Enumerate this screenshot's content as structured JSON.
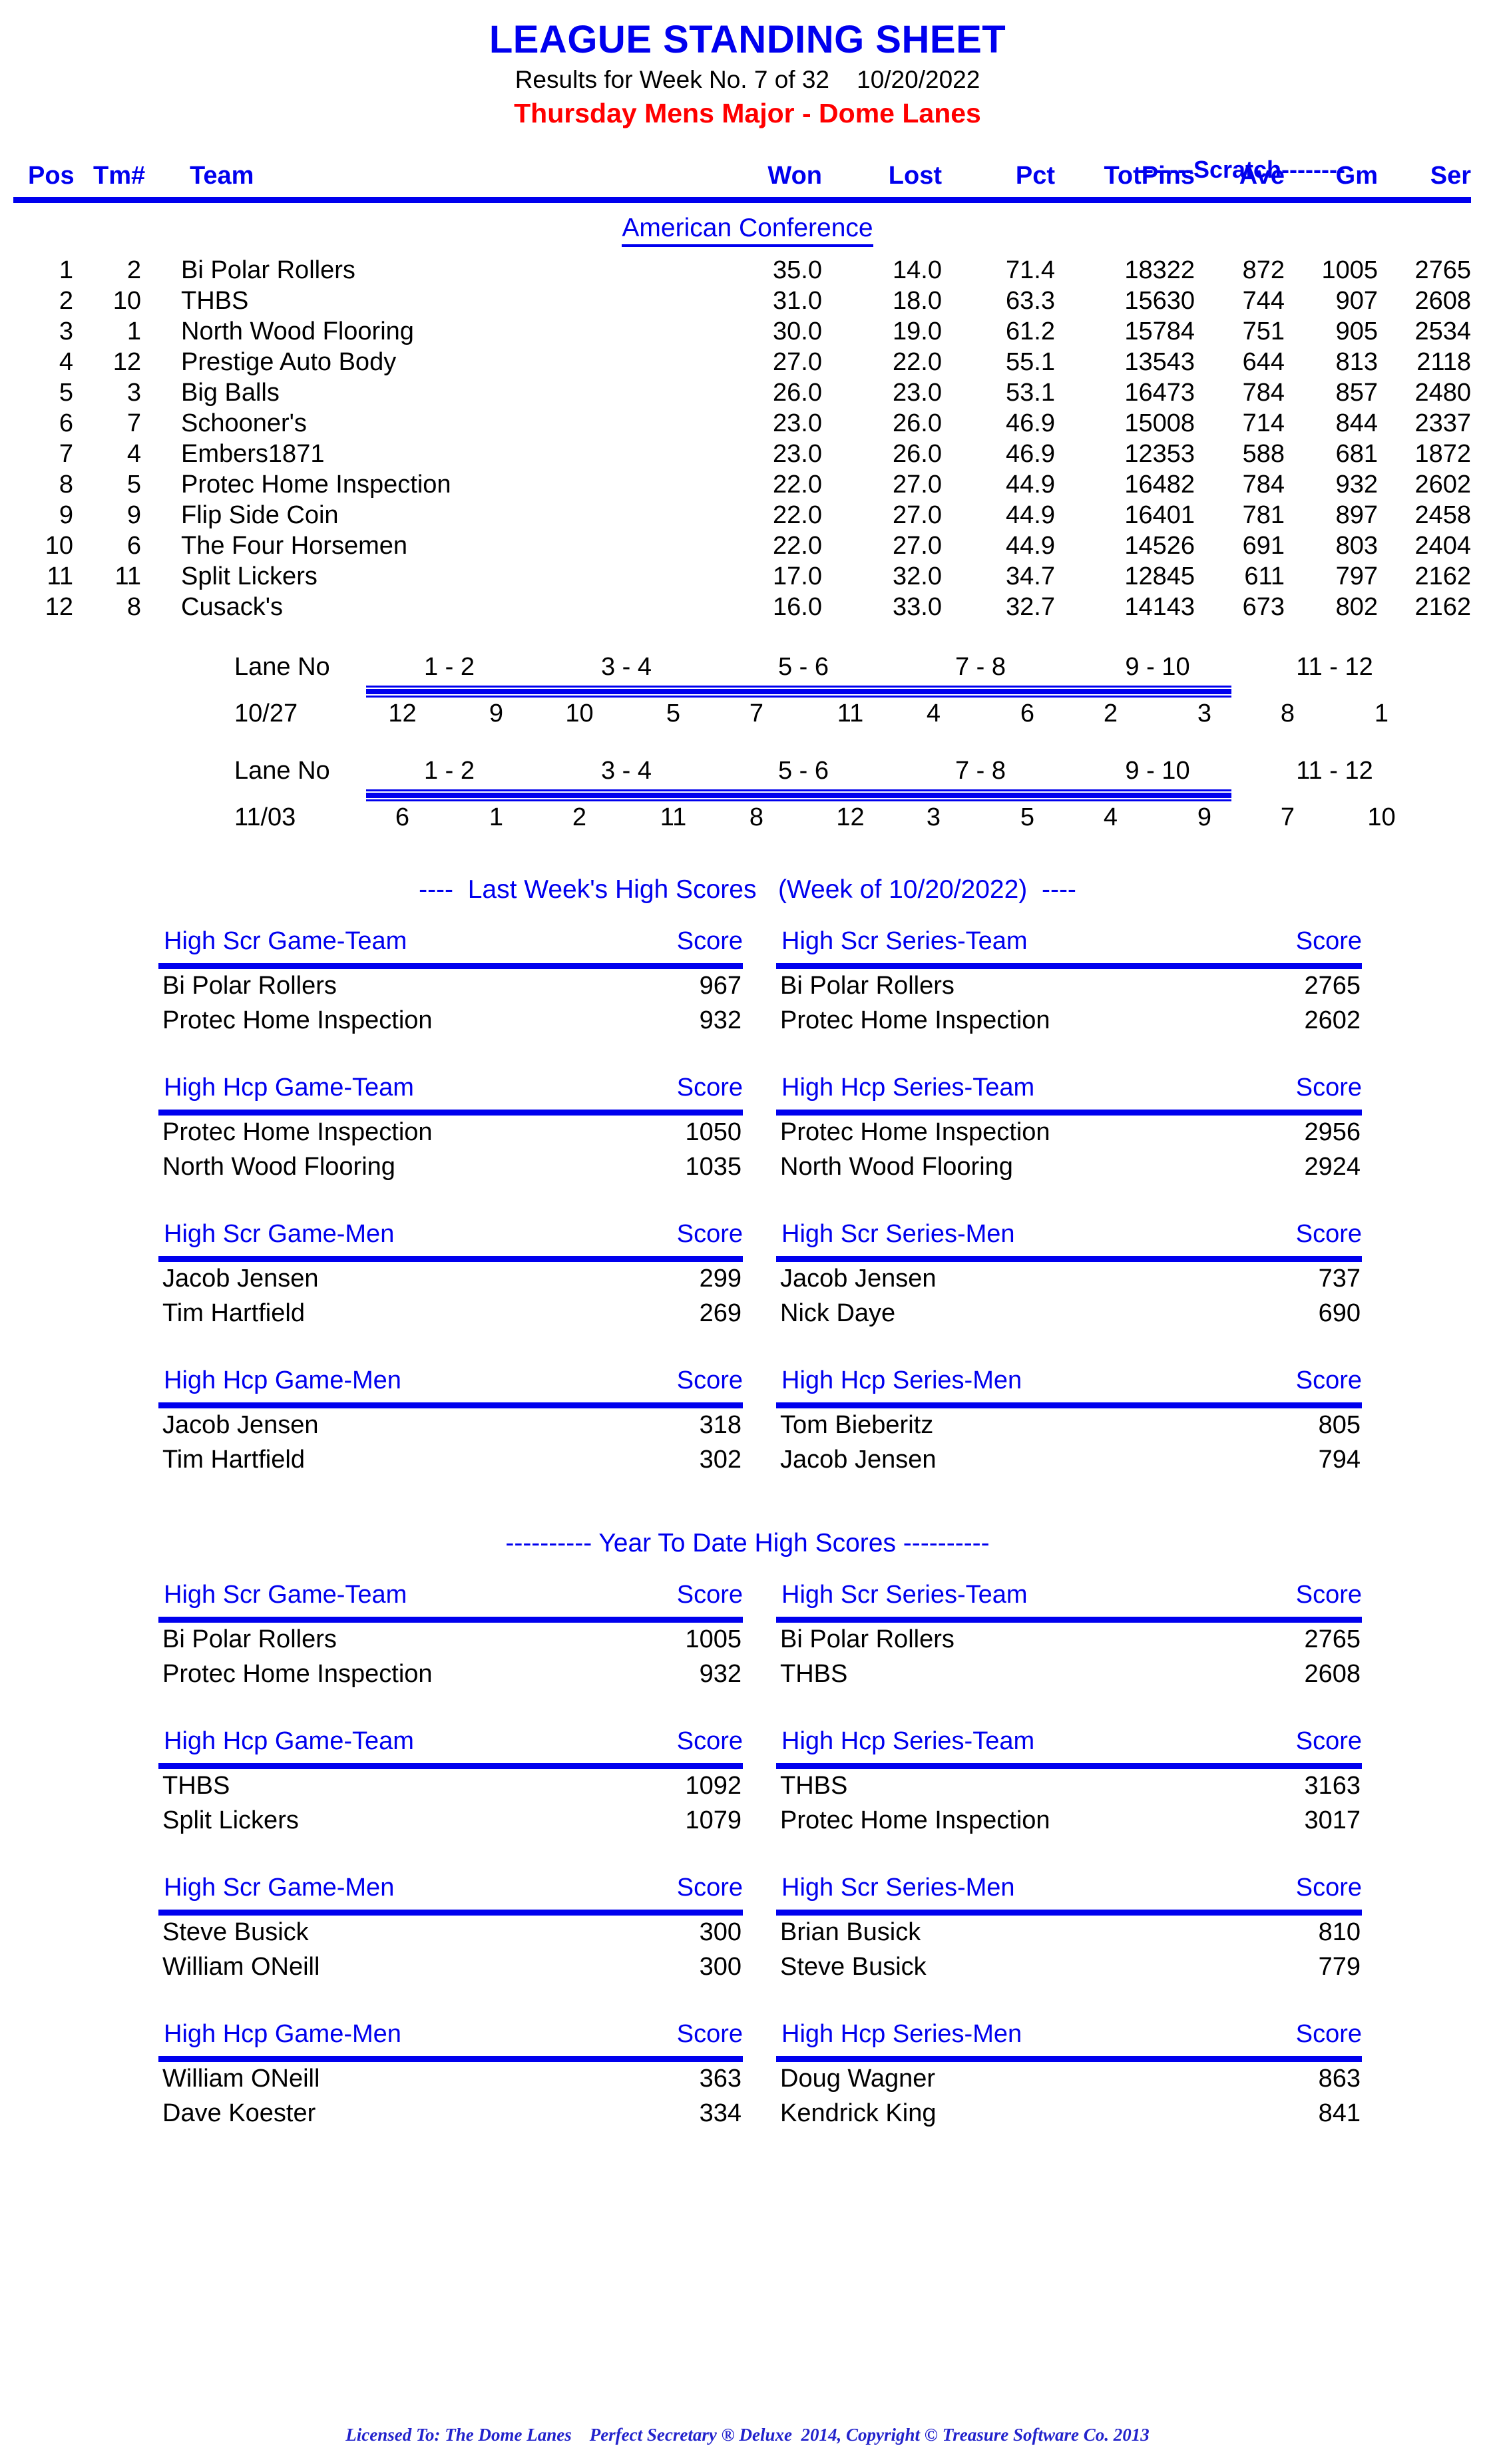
{
  "header": {
    "title": "LEAGUE STANDING SHEET",
    "results_line": "Results for Week No. 7 of 32    10/20/2022",
    "league": "Thursday Mens Major - Dome Lanes"
  },
  "colors": {
    "accent_blue": "#0000ee",
    "league_red": "#ff0000",
    "text_black": "#000000"
  },
  "standings": {
    "scratch_label": "-------Scratch--------",
    "columns": {
      "pos": "Pos",
      "tm": "Tm#",
      "team": "Team",
      "won": "Won",
      "lost": "Lost",
      "pct": "Pct",
      "totpins": "TotPins",
      "ave": "Ave",
      "gm": "Gm",
      "ser": "Ser"
    },
    "conference": "American Conference",
    "rows": [
      {
        "pos": "1",
        "tm": "2",
        "team": "Bi Polar Rollers",
        "won": "35.0",
        "lost": "14.0",
        "pct": "71.4",
        "totpins": "18322",
        "ave": "872",
        "gm": "1005",
        "ser": "2765"
      },
      {
        "pos": "2",
        "tm": "10",
        "team": "THBS",
        "won": "31.0",
        "lost": "18.0",
        "pct": "63.3",
        "totpins": "15630",
        "ave": "744",
        "gm": "907",
        "ser": "2608"
      },
      {
        "pos": "3",
        "tm": "1",
        "team": "North Wood Flooring",
        "won": "30.0",
        "lost": "19.0",
        "pct": "61.2",
        "totpins": "15784",
        "ave": "751",
        "gm": "905",
        "ser": "2534"
      },
      {
        "pos": "4",
        "tm": "12",
        "team": "Prestige Auto Body",
        "won": "27.0",
        "lost": "22.0",
        "pct": "55.1",
        "totpins": "13543",
        "ave": "644",
        "gm": "813",
        "ser": "2118"
      },
      {
        "pos": "5",
        "tm": "3",
        "team": "Big Balls",
        "won": "26.0",
        "lost": "23.0",
        "pct": "53.1",
        "totpins": "16473",
        "ave": "784",
        "gm": "857",
        "ser": "2480"
      },
      {
        "pos": "6",
        "tm": "7",
        "team": "Schooner's",
        "won": "23.0",
        "lost": "26.0",
        "pct": "46.9",
        "totpins": "15008",
        "ave": "714",
        "gm": "844",
        "ser": "2337"
      },
      {
        "pos": "7",
        "tm": "4",
        "team": "Embers1871",
        "won": "23.0",
        "lost": "26.0",
        "pct": "46.9",
        "totpins": "12353",
        "ave": "588",
        "gm": "681",
        "ser": "1872"
      },
      {
        "pos": "8",
        "tm": "5",
        "team": "Protec Home Inspection",
        "won": "22.0",
        "lost": "27.0",
        "pct": "44.9",
        "totpins": "16482",
        "ave": "784",
        "gm": "932",
        "ser": "2602"
      },
      {
        "pos": "9",
        "tm": "9",
        "team": "Flip Side Coin",
        "won": "22.0",
        "lost": "27.0",
        "pct": "44.9",
        "totpins": "16401",
        "ave": "781",
        "gm": "897",
        "ser": "2458"
      },
      {
        "pos": "10",
        "tm": "6",
        "team": "The Four Horsemen",
        "won": "22.0",
        "lost": "27.0",
        "pct": "44.9",
        "totpins": "14526",
        "ave": "691",
        "gm": "803",
        "ser": "2404"
      },
      {
        "pos": "11",
        "tm": "11",
        "team": "Split Lickers",
        "won": "17.0",
        "lost": "32.0",
        "pct": "34.7",
        "totpins": "12845",
        "ave": "611",
        "gm": "797",
        "ser": "2162"
      },
      {
        "pos": "12",
        "tm": "8",
        "team": "Cusack's",
        "won": "16.0",
        "lost": "33.0",
        "pct": "32.7",
        "totpins": "14143",
        "ave": "673",
        "gm": "802",
        "ser": "2162"
      }
    ]
  },
  "lane_schedules": [
    {
      "label": "Lane No",
      "date": "10/27",
      "pairs": [
        "1 - 2",
        "3 - 4",
        "5 - 6",
        "7 - 8",
        "9 - 10",
        "11 - 12"
      ],
      "matchups": [
        [
          "12",
          "9"
        ],
        [
          "10",
          "5"
        ],
        [
          "7",
          "11"
        ],
        [
          "4",
          "6"
        ],
        [
          "2",
          "3"
        ],
        [
          "8",
          "1"
        ]
      ]
    },
    {
      "label": "Lane No",
      "date": "11/03",
      "pairs": [
        "1 - 2",
        "3 - 4",
        "5 - 6",
        "7 - 8",
        "9 - 10",
        "11 - 12"
      ],
      "matchups": [
        [
          "6",
          "1"
        ],
        [
          "2",
          "11"
        ],
        [
          "8",
          "12"
        ],
        [
          "3",
          "5"
        ],
        [
          "4",
          "9"
        ],
        [
          "7",
          "10"
        ]
      ]
    }
  ],
  "last_week": {
    "section_title": "----  Last Week's High Scores   (Week of 10/20/2022)  ----",
    "score_label": "Score",
    "groups": [
      {
        "left": {
          "category": "High Scr Game-Team",
          "rows": [
            {
              "name": "Bi Polar Rollers",
              "score": "967"
            },
            {
              "name": "Protec Home Inspection",
              "score": "932"
            }
          ]
        },
        "right": {
          "category": "High Scr Series-Team",
          "rows": [
            {
              "name": "Bi Polar Rollers",
              "score": "2765"
            },
            {
              "name": "Protec Home Inspection",
              "score": "2602"
            }
          ]
        }
      },
      {
        "left": {
          "category": "High Hcp Game-Team",
          "rows": [
            {
              "name": "Protec Home Inspection",
              "score": "1050"
            },
            {
              "name": "North Wood Flooring",
              "score": "1035"
            }
          ]
        },
        "right": {
          "category": "High Hcp Series-Team",
          "rows": [
            {
              "name": "Protec Home Inspection",
              "score": "2956"
            },
            {
              "name": "North Wood Flooring",
              "score": "2924"
            }
          ]
        }
      },
      {
        "left": {
          "category": "High Scr Game-Men",
          "rows": [
            {
              "name": "Jacob Jensen",
              "score": "299"
            },
            {
              "name": "Tim Hartfield",
              "score": "269"
            }
          ]
        },
        "right": {
          "category": "High Scr Series-Men",
          "rows": [
            {
              "name": "Jacob Jensen",
              "score": "737"
            },
            {
              "name": "Nick Daye",
              "score": "690"
            }
          ]
        }
      },
      {
        "left": {
          "category": "High Hcp Game-Men",
          "rows": [
            {
              "name": "Jacob Jensen",
              "score": "318"
            },
            {
              "name": "Tim Hartfield",
              "score": "302"
            }
          ]
        },
        "right": {
          "category": "High Hcp Series-Men",
          "rows": [
            {
              "name": "Tom Bieberitz",
              "score": "805"
            },
            {
              "name": "Jacob Jensen",
              "score": "794"
            }
          ]
        }
      }
    ]
  },
  "year_to_date": {
    "section_title": "---------- Year To Date High Scores ----------",
    "score_label": "Score",
    "groups": [
      {
        "left": {
          "category": "High Scr Game-Team",
          "rows": [
            {
              "name": "Bi Polar Rollers",
              "score": "1005"
            },
            {
              "name": "Protec Home Inspection",
              "score": "932"
            }
          ]
        },
        "right": {
          "category": "High Scr Series-Team",
          "rows": [
            {
              "name": "Bi Polar Rollers",
              "score": "2765"
            },
            {
              "name": "THBS",
              "score": "2608"
            }
          ]
        }
      },
      {
        "left": {
          "category": "High Hcp Game-Team",
          "rows": [
            {
              "name": "THBS",
              "score": "1092"
            },
            {
              "name": "Split Lickers",
              "score": "1079"
            }
          ]
        },
        "right": {
          "category": "High Hcp Series-Team",
          "rows": [
            {
              "name": "THBS",
              "score": "3163"
            },
            {
              "name": "Protec Home Inspection",
              "score": "3017"
            }
          ]
        }
      },
      {
        "left": {
          "category": "High Scr Game-Men",
          "rows": [
            {
              "name": "Steve Busick",
              "score": "300"
            },
            {
              "name": "William ONeill",
              "score": "300"
            }
          ]
        },
        "right": {
          "category": "High Scr Series-Men",
          "rows": [
            {
              "name": "Brian Busick",
              "score": "810"
            },
            {
              "name": "Steve Busick",
              "score": "779"
            }
          ]
        }
      },
      {
        "left": {
          "category": "High Hcp Game-Men",
          "rows": [
            {
              "name": "William ONeill",
              "score": "363"
            },
            {
              "name": "Dave Koester",
              "score": "334"
            }
          ]
        },
        "right": {
          "category": "High Hcp Series-Men",
          "rows": [
            {
              "name": "Doug Wagner",
              "score": "863"
            },
            {
              "name": "Kendrick King",
              "score": "841"
            }
          ]
        }
      }
    ]
  },
  "footer": {
    "text": "Licensed To: The Dome Lanes    Perfect Secretary ® Deluxe  2014, Copyright © Treasure Software Co. 2013"
  }
}
